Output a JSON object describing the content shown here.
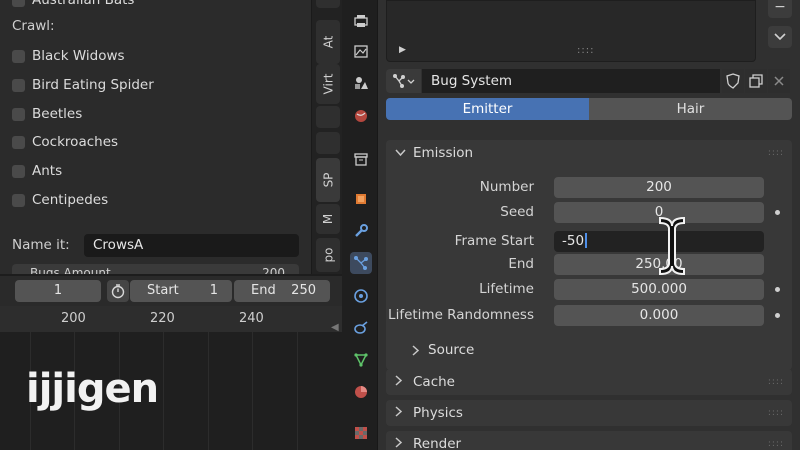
{
  "left_panel": {
    "top_item": "Australian Bats",
    "crawl_heading": "Crawl:",
    "checkboxes": [
      {
        "label": "Black Widows",
        "checked": false
      },
      {
        "label": "Bird Eating Spider",
        "checked": false
      },
      {
        "label": "Beetles",
        "checked": false
      },
      {
        "label": "Cockroaches",
        "checked": false
      },
      {
        "label": "Ants",
        "checked": false
      },
      {
        "label": "Centipedes",
        "checked": false
      }
    ],
    "name_label": "Name it:",
    "name_value": "CrowsA",
    "bugs_amount_label": "Bugs Amount",
    "bugs_amount_value": "200"
  },
  "side_tabs": [
    "At",
    "Virt",
    "SP",
    "M",
    "po"
  ],
  "timeline": {
    "current_frame": "1",
    "start_label": "Start",
    "start_value": "1",
    "end_label": "End",
    "end_value": "250",
    "ruler_marks": [
      "200",
      "220",
      "240"
    ]
  },
  "logo_text": "ijjigen",
  "properties": {
    "particle_system_name": "Bug System",
    "tabs": {
      "emitter": "Emitter",
      "hair": "Hair"
    },
    "emission": {
      "title": "Emission",
      "rows": [
        {
          "label": "Number",
          "value": "200"
        },
        {
          "label": "Seed",
          "value": "0"
        },
        {
          "label": "Frame Start",
          "value": "-50"
        },
        {
          "label": "End",
          "value": "250.00"
        },
        {
          "label": "Lifetime",
          "value": "500.000"
        },
        {
          "label": "Lifetime Randomness",
          "value": "0.000"
        }
      ],
      "source_title": "Source"
    },
    "panels": {
      "cache": "Cache",
      "physics": "Physics",
      "render": "Render"
    }
  },
  "colors": {
    "accent_blue": "#4772b3",
    "background": "#303030",
    "field": "#545454"
  }
}
